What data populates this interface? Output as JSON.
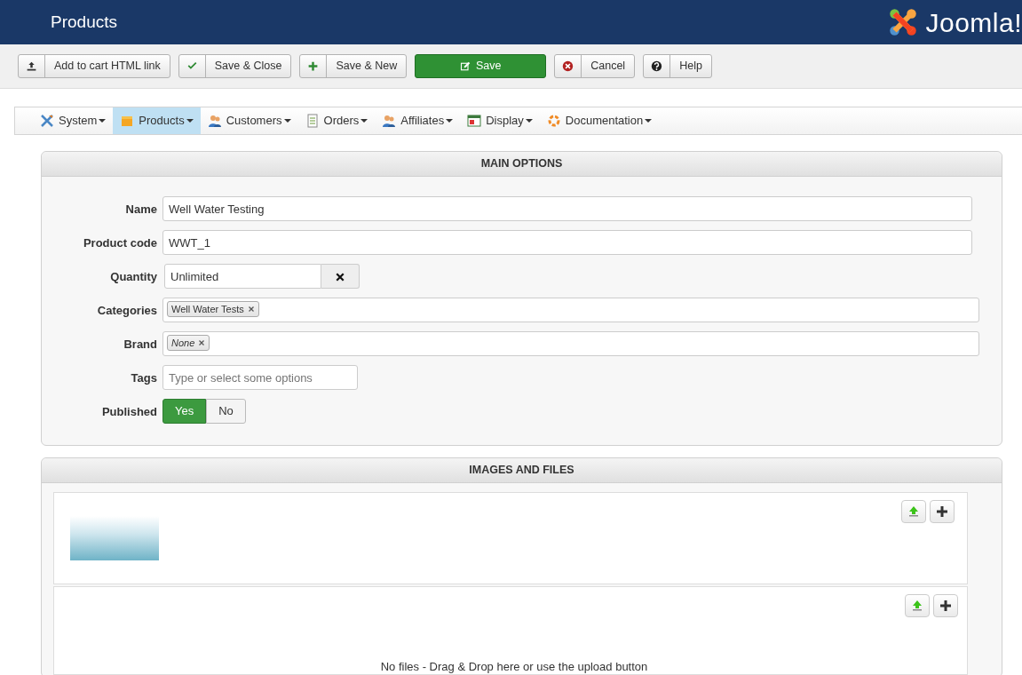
{
  "header": {
    "title": "Products",
    "logo_text": "Joomla!"
  },
  "toolbar": [
    {
      "label": "Add to cart HTML link",
      "kind": "upload"
    },
    {
      "label": "Save & Close",
      "kind": "check"
    },
    {
      "label": "Save & New",
      "kind": "plus"
    },
    {
      "label": "Save",
      "kind": "primary"
    },
    {
      "label": "Cancel",
      "kind": "cancel"
    },
    {
      "label": "Help",
      "kind": "help"
    }
  ],
  "menu": [
    {
      "label": "System",
      "selected": false
    },
    {
      "label": "Products",
      "selected": true
    },
    {
      "label": "Customers",
      "selected": false
    },
    {
      "label": "Orders",
      "selected": false
    },
    {
      "label": "Affiliates",
      "selected": false
    },
    {
      "label": "Display",
      "selected": false
    },
    {
      "label": "Documentation",
      "selected": false
    }
  ],
  "main_options": {
    "title": "MAIN OPTIONS",
    "fields": [
      {
        "label": "Name",
        "kind": "text",
        "value": "Well Water Testing"
      },
      {
        "label": "Product code",
        "kind": "text",
        "value": "WWT_1"
      },
      {
        "label": "Quantity",
        "kind": "quantity",
        "value": "Unlimited"
      },
      {
        "label": "Categories",
        "kind": "tags",
        "tags": [
          {
            "label": "Well Water Tests",
            "italic": false
          }
        ]
      },
      {
        "label": "Brand",
        "kind": "tags",
        "tags": [
          {
            "label": "None",
            "italic": true
          }
        ]
      },
      {
        "label": "Tags",
        "kind": "select",
        "placeholder": "Type or select some options"
      },
      {
        "label": "Published",
        "kind": "toggle",
        "options": [
          {
            "label": "Yes",
            "selected": true
          },
          {
            "label": "No",
            "selected": false
          }
        ]
      }
    ]
  },
  "images_and_files": {
    "title": "IMAGES AND FILES",
    "files_message": "No files - Drag & Drop here or use the upload button"
  }
}
